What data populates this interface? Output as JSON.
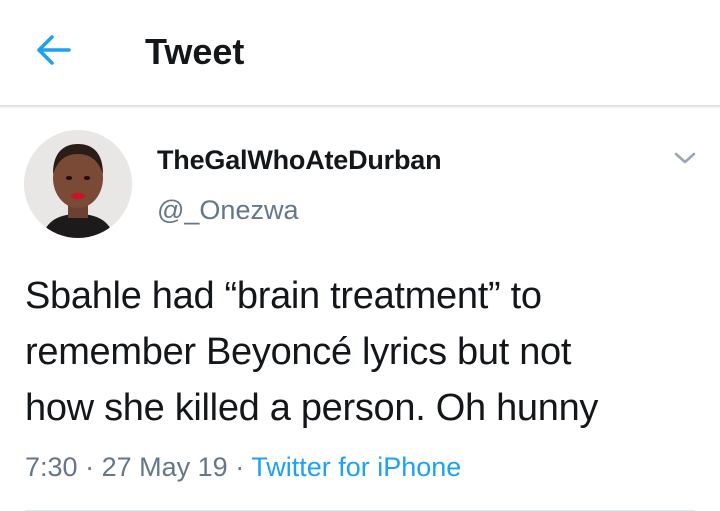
{
  "header": {
    "title": "Tweet",
    "back_icon": "arrow-left-icon"
  },
  "colors": {
    "accent": "#1da1f2",
    "secondary_text": "#657786",
    "primary_text": "#14171a"
  },
  "tweet": {
    "display_name": "TheGalWhoAteDurban",
    "handle": "@_Onezwa",
    "caret_icon": "chevron-down-icon",
    "text_lines": [
      "Sbahle had “brain treatment” to",
      "remember Beyoncé lyrics but not",
      "how she killed a person. Oh hunny"
    ],
    "time": "7:30",
    "date": "27 May 19",
    "separator": "·",
    "source": "Twitter for iPhone"
  }
}
